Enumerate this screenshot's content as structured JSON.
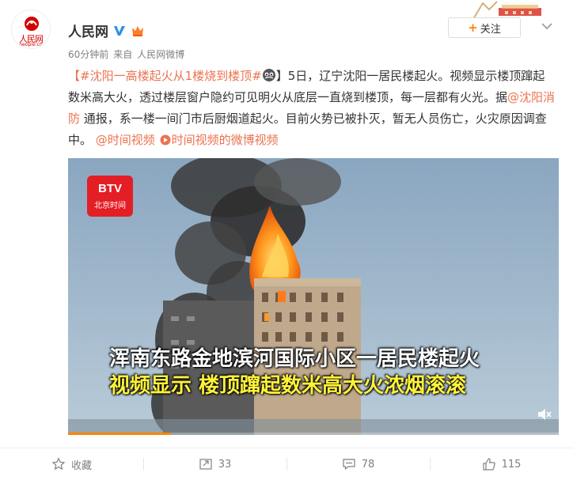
{
  "user": {
    "name": "人民网",
    "avatar_text": "人民网",
    "avatar_url": "people.cn",
    "time": "60分钟前",
    "source_prefix": "来自",
    "source": "人民网微博"
  },
  "follow": {
    "label": "关注"
  },
  "post": {
    "hashtag": "【#沈阳一高楼起火从1楼烧到楼顶#",
    "after_tag": "】5日，辽宁沈阳一居民楼起火。视频显示楼顶蹿起数米高大火，透过楼层窗户隐约可见明火从底层一直烧到楼顶，每一层都有火光。据",
    "mention": "@沈阳消防",
    "body2": " 通报，系一楼一间门市后厨烟道起火。目前火势已被扑灭，暂无人员伤亡，火灾原因调查中。",
    "mention2": "@时间视频",
    "video_link": "时间视频的微博视频"
  },
  "video": {
    "channel_logo": "BTV",
    "channel_sub": "北京时间",
    "caption_line1": "浑南东路金地滨河国际小区一居民楼起火",
    "caption_line2": "视频显示 楼顶蹿起数米高大火浓烟滚滚",
    "progress_fraction": 0.21
  },
  "actions": {
    "favorite": "收藏",
    "repost": "33",
    "comment": "78",
    "like": "115"
  },
  "colors": {
    "link": "#eb7350",
    "accent": "#ff8200",
    "brand_red": "#d40000"
  }
}
